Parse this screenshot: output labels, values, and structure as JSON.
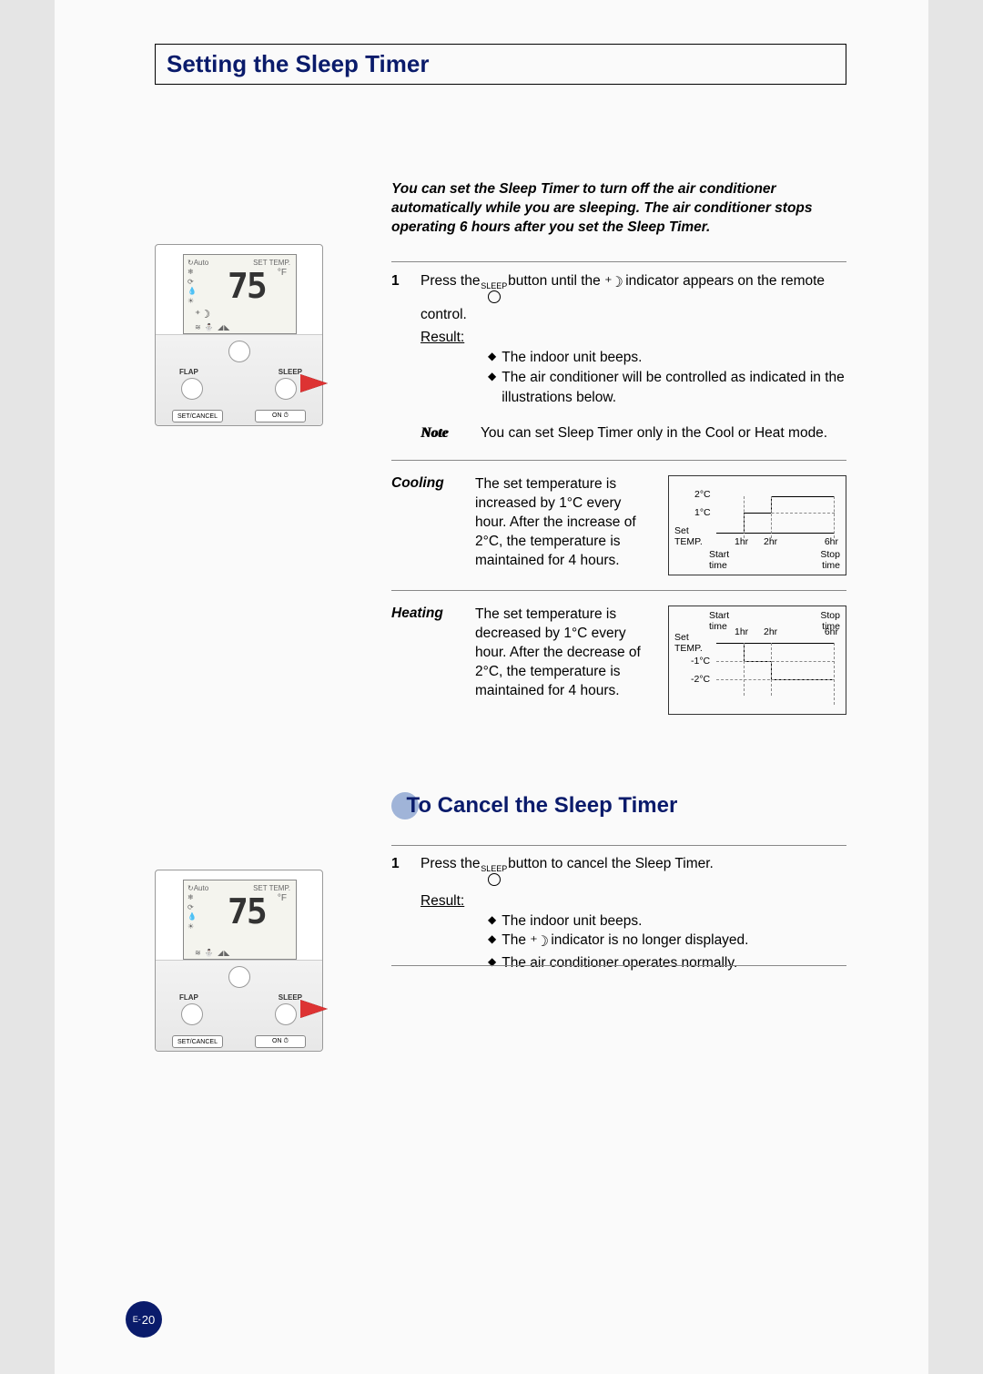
{
  "page_number_prefix": "E-",
  "page_number": "20",
  "section1": {
    "title": "Setting the Sleep Timer",
    "intro": "You can set the Sleep Timer to turn off the air conditioner automatically while you are sleeping. The air conditioner stops operating 6 hours after you set the Sleep Timer.",
    "step_number": "1",
    "step_text_1": "Press the ",
    "step_text_2": " button until the ",
    "step_text_3": " indicator appears on the remote control.",
    "sleep_label": "SLEEP",
    "result_label": "Result:",
    "result_1": "The indoor unit beeps.",
    "result_2": "The air conditioner will be controlled as indicated in the illustrations below.",
    "note_label": "Note",
    "note_text": "You can set Sleep Timer only in the Cool or Heat mode.",
    "cooling": {
      "label": "Cooling",
      "text": "The set temperature is increased by 1°C every hour. After the increase of 2°C, the temperature is maintained for 4 hours.",
      "graph": {
        "y2": "2°C",
        "y1": "1°C",
        "set_temp_1": "Set",
        "set_temp_2": "TEMP.",
        "x1": "1hr",
        "x2": "2hr",
        "x6": "6hr",
        "start": "Start",
        "stop": "Stop",
        "time": "time"
      }
    },
    "heating": {
      "label": "Heating",
      "text": "The set temperature is decreased by 1°C every hour. After the decrease of 2°C, the temperature is maintained for 4 hours.",
      "graph": {
        "y1": "-1°C",
        "y2": "-2°C",
        "set_temp_1": "Set",
        "set_temp_2": "TEMP.",
        "x1": "1hr",
        "x2": "2hr",
        "x6": "6hr",
        "start": "Start",
        "stop": "Stop",
        "time": "time"
      }
    }
  },
  "section2": {
    "title": "To Cancel the Sleep Timer",
    "step_number": "1",
    "step_text_1": "Press the ",
    "step_text_2": " button to cancel the Sleep Timer.",
    "sleep_label": "SLEEP",
    "result_label": "Result:",
    "result_1": "The indoor unit beeps.",
    "result_2a": "The ",
    "result_2b": " indicator is no longer displayed.",
    "result_3": "The air conditioner operates normally."
  },
  "remote": {
    "set_temp_label": "SET TEMP.",
    "temp_value": "75",
    "unit": "°F",
    "flap": "FLAP",
    "sleep": "SLEEP",
    "set_cancel": "SET/CANCEL",
    "on": "ON ⏱",
    "auto": "Auto"
  },
  "shared": {
    "moon_glyph": "⁺☽"
  }
}
